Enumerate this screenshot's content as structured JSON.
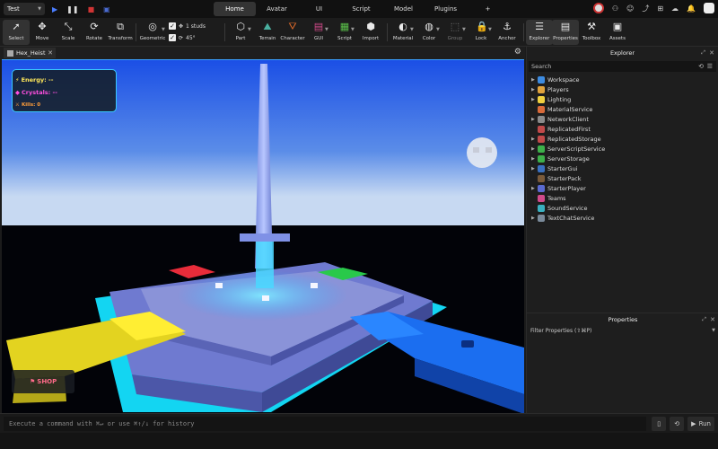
{
  "topbar": {
    "project": "Test",
    "tabs": [
      "Home",
      "Avatar",
      "UI",
      "Script",
      "Model",
      "Plugins",
      "+"
    ],
    "active_tab": "Home"
  },
  "ribbon": {
    "tools": [
      {
        "label": "Select",
        "icon": "cursor-icon"
      },
      {
        "label": "Move",
        "icon": "move-icon"
      },
      {
        "label": "Scale",
        "icon": "scale-icon"
      },
      {
        "label": "Rotate",
        "icon": "rotate-icon"
      },
      {
        "label": "Transform",
        "icon": "transform-icon"
      },
      {
        "label": "Geometric",
        "icon": "geometric-icon"
      },
      {
        "label": "Part",
        "icon": "part-icon"
      },
      {
        "label": "Terrain",
        "icon": "terrain-icon"
      },
      {
        "label": "Character",
        "icon": "character-icon"
      },
      {
        "label": "GUI",
        "icon": "gui-icon"
      },
      {
        "label": "Script",
        "icon": "script-icon"
      },
      {
        "label": "Import",
        "icon": "import-icon"
      },
      {
        "label": "Material",
        "icon": "material-icon"
      },
      {
        "label": "Color",
        "icon": "color-icon"
      },
      {
        "label": "Group",
        "icon": "group-icon"
      },
      {
        "label": "Lock",
        "icon": "lock-icon"
      },
      {
        "label": "Anchor",
        "icon": "anchor-icon"
      },
      {
        "label": "Explorer",
        "icon": "explorer-icon"
      },
      {
        "label": "Properties",
        "icon": "properties-icon"
      },
      {
        "label": "Toolbox",
        "icon": "toolbox-icon"
      },
      {
        "label": "Assets",
        "icon": "assets-icon"
      }
    ],
    "snap_move": "1 studs",
    "snap_rotate": "45°"
  },
  "doc_tab": "Hex_Heist",
  "hud": {
    "energy": "Energy: --",
    "crystals": "Crystals: --",
    "kills": "Kills: 0"
  },
  "shop": "SHOP",
  "explorer": {
    "title": "Explorer",
    "search_placeholder": "Search",
    "items": [
      {
        "label": "Workspace",
        "expandable": true,
        "color": "#3d8be0"
      },
      {
        "label": "Players",
        "expandable": true,
        "color": "#e0a33d"
      },
      {
        "label": "Lighting",
        "expandable": true,
        "color": "#f0d040"
      },
      {
        "label": "MaterialService",
        "expandable": false,
        "color": "#d86a3a"
      },
      {
        "label": "NetworkClient",
        "expandable": true,
        "color": "#8a8a8a"
      },
      {
        "label": "ReplicatedFirst",
        "expandable": false,
        "color": "#c04a4a"
      },
      {
        "label": "ReplicatedStorage",
        "expandable": true,
        "color": "#c04a4a"
      },
      {
        "label": "ServerScriptService",
        "expandable": true,
        "color": "#3db04a"
      },
      {
        "label": "ServerStorage",
        "expandable": true,
        "color": "#3db04a"
      },
      {
        "label": "StarterGui",
        "expandable": true,
        "color": "#3a70c0"
      },
      {
        "label": "StarterPack",
        "expandable": false,
        "color": "#7a5a3a"
      },
      {
        "label": "StarterPlayer",
        "expandable": true,
        "color": "#5a6ad0"
      },
      {
        "label": "Teams",
        "expandable": false,
        "color": "#d04a8a"
      },
      {
        "label": "SoundService",
        "expandable": false,
        "color": "#3ab0c0"
      },
      {
        "label": "TextChatService",
        "expandable": true,
        "color": "#7a8a9a"
      }
    ]
  },
  "properties": {
    "title": "Properties",
    "filter_placeholder": "Filter Properties (⇧⌘P)"
  },
  "command_bar": {
    "placeholder": "Execute a command with ⌘↵ or use ⌘↑/↓ for history",
    "run": "Run"
  }
}
